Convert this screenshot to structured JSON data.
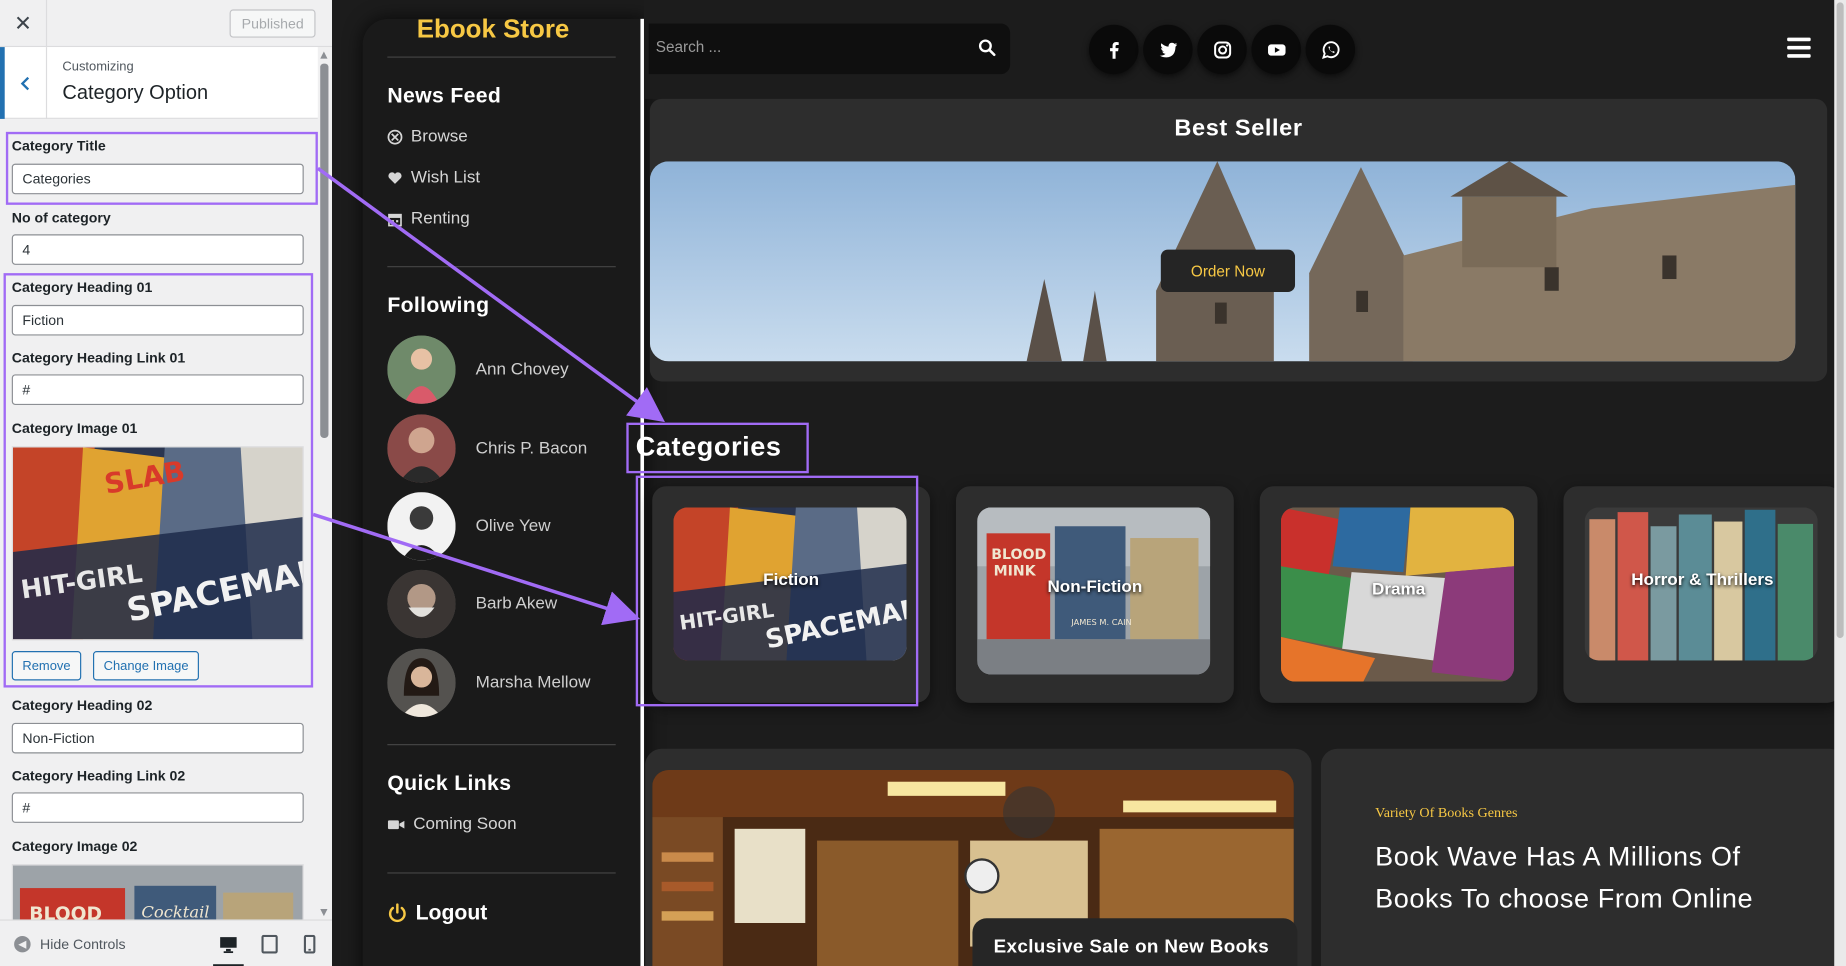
{
  "customizer": {
    "close_label": "✕",
    "published_label": "Published",
    "subtitle": "Customizing",
    "title": "Category Option",
    "fields": {
      "category_title_label": "Category Title",
      "category_title_value": "Categories",
      "no_of_category_label": "No of category",
      "no_of_category_value": "4",
      "heading_01_label": "Category Heading 01",
      "heading_01_value": "Fiction",
      "heading_link_01_label": "Category Heading Link 01",
      "heading_link_01_value": "#",
      "image_01_label": "Category Image 01",
      "remove_label": "Remove",
      "change_image_label": "Change Image",
      "heading_02_label": "Category Heading 02",
      "heading_02_value": "Non-Fiction",
      "heading_link_02_label": "Category Heading Link 02",
      "heading_link_02_value": "#",
      "image_02_label": "Category Image 02"
    },
    "footer": {
      "hide_controls_label": "Hide Controls",
      "active_device": "desktop"
    }
  },
  "site": {
    "logo": "Ebook Store",
    "news_feed": {
      "heading": "News Feed",
      "items": [
        {
          "label": "Browse",
          "icon": "compass-icon"
        },
        {
          "label": "Wish List",
          "icon": "heart-icon"
        },
        {
          "label": "Renting",
          "icon": "calendar-icon"
        }
      ]
    },
    "following": {
      "heading": "Following",
      "people": [
        {
          "name": "Ann Chovey"
        },
        {
          "name": "Chris P. Bacon"
        },
        {
          "name": "Olive Yew"
        },
        {
          "name": "Barb Akew"
        },
        {
          "name": "Marsha Mellow"
        }
      ]
    },
    "quick_links": {
      "heading": "Quick Links",
      "items": [
        {
          "label": "Coming Soon",
          "icon": "video-camera-icon"
        }
      ]
    },
    "logout_label": "Logout",
    "search": {
      "placeholder": "Search ..."
    },
    "social_icons": [
      "facebook-icon",
      "twitter-icon",
      "instagram-icon",
      "youtube-icon",
      "whatsapp-icon"
    ],
    "best_seller": {
      "title": "Best Seller",
      "button_label": "Order Now"
    },
    "categories": {
      "title": "Categories",
      "items": [
        {
          "name": "Fiction"
        },
        {
          "name": "Non-Fiction"
        },
        {
          "name": "Drama"
        },
        {
          "name": "Horror & Thrillers"
        }
      ]
    },
    "promo": {
      "sale_label": "Exclusive Sale on New Books",
      "eyebrow": "Variety Of Books Genres",
      "headline": "Book Wave Has A Millions Of Books To choose From Online"
    }
  },
  "colors": {
    "accent_highlight": "#a16bf5",
    "brand_yellow": "#f7c844",
    "wp_blue": "#2271b1"
  }
}
